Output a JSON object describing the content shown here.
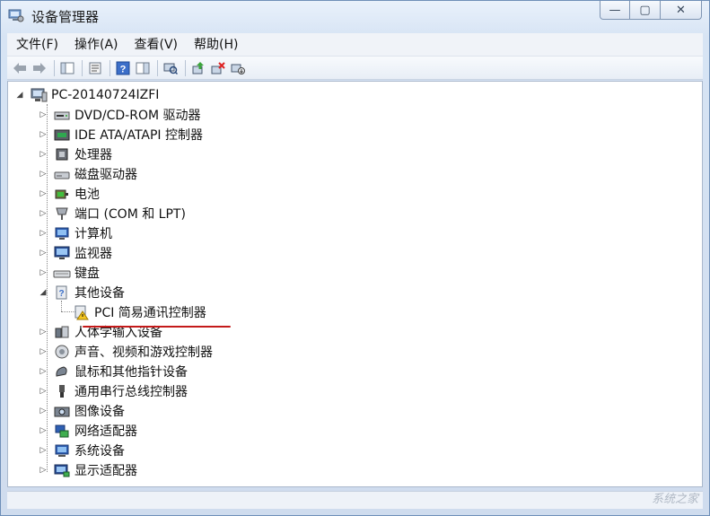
{
  "window": {
    "title": "设备管理器",
    "caption": {
      "minimize": "—",
      "maximize": "▢",
      "close": "✕"
    }
  },
  "menubar": {
    "items": [
      "文件(F)",
      "操作(A)",
      "查看(V)",
      "帮助(H)"
    ]
  },
  "toolbar": {
    "buttons": [
      "back-icon",
      "forward-icon",
      "show-hide-console-tree-icon",
      "properties-icon",
      "help-icon",
      "action-pane-icon",
      "scan-hardware-icon",
      "update-driver-icon",
      "uninstall-icon",
      "disable-icon"
    ]
  },
  "tree": {
    "root": "PC-20140724IZFI",
    "items": [
      {
        "label": "DVD/CD-ROM 驱动器",
        "icon": "dvd-drive-icon",
        "expanded": false
      },
      {
        "label": "IDE ATA/ATAPI 控制器",
        "icon": "ide-controller-icon",
        "expanded": false
      },
      {
        "label": "处理器",
        "icon": "processor-icon",
        "expanded": false
      },
      {
        "label": "磁盘驱动器",
        "icon": "disk-drive-icon",
        "expanded": false
      },
      {
        "label": "电池",
        "icon": "battery-icon",
        "expanded": false
      },
      {
        "label": "端口 (COM 和 LPT)",
        "icon": "port-icon",
        "expanded": false
      },
      {
        "label": "计算机",
        "icon": "computer-icon",
        "expanded": false
      },
      {
        "label": "监视器",
        "icon": "monitor-icon",
        "expanded": false
      },
      {
        "label": "键盘",
        "icon": "keyboard-icon",
        "expanded": false
      },
      {
        "label": "其他设备",
        "icon": "other-devices-icon",
        "expanded": true
      },
      {
        "label": "PCI 简易通讯控制器",
        "icon": "warning-device-icon",
        "child": true
      },
      {
        "label": "人体学输入设备",
        "icon": "hid-icon",
        "expanded": false
      },
      {
        "label": "声音、视频和游戏控制器",
        "icon": "sound-icon",
        "expanded": false
      },
      {
        "label": "鼠标和其他指针设备",
        "icon": "mouse-icon",
        "expanded": false
      },
      {
        "label": "通用串行总线控制器",
        "icon": "usb-icon",
        "expanded": false
      },
      {
        "label": "图像设备",
        "icon": "camera-icon",
        "expanded": false
      },
      {
        "label": "网络适配器",
        "icon": "network-icon",
        "expanded": false
      },
      {
        "label": "系统设备",
        "icon": "system-icon",
        "expanded": false
      },
      {
        "label": "显示适配器",
        "icon": "display-adapter-icon",
        "expanded": false
      }
    ]
  },
  "watermark": "系统之家"
}
